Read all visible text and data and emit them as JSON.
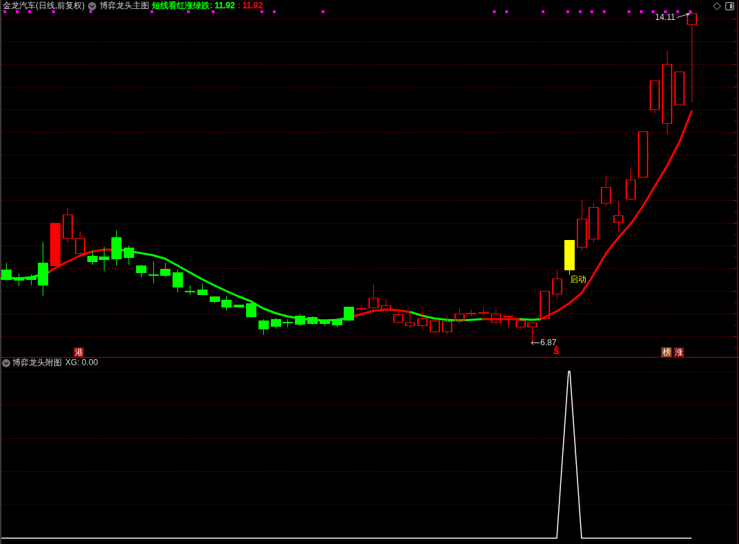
{
  "main_chart": {
    "security": "金龙汽车(日线,前复权)",
    "indicator": "博弈龙头主图",
    "legend": [
      {
        "label": "短线看红涨绿跌:",
        "value": "11.92",
        "color": "#00ff00"
      },
      {
        "label": ":",
        "value": "11.92",
        "color": "#ff0000"
      }
    ],
    "price_labels": [
      {
        "kind": "high",
        "text": "14.11"
      },
      {
        "kind": "low",
        "text": "6.87"
      }
    ],
    "signal_label": "启动",
    "markers": [
      {
        "kind": "badge",
        "text": "港",
        "color": "#a00000"
      },
      {
        "kind": "plain",
        "text": "Ŝ",
        "color": "#ff0000"
      },
      {
        "kind": "badge",
        "text": "榜",
        "color": "#8b4513"
      },
      {
        "kind": "badge",
        "text": "涨",
        "color": "#800000"
      }
    ]
  },
  "sub_chart": {
    "indicator": "博弈龙头附图",
    "reading": "XG: 0.00"
  }
}
